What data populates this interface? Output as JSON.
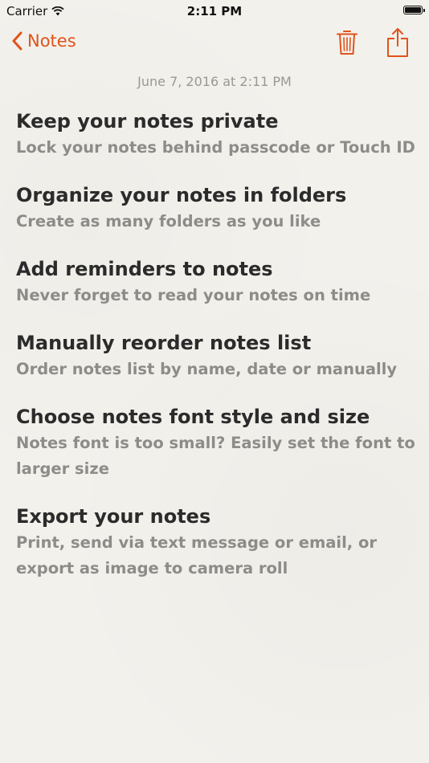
{
  "status_bar": {
    "carrier": "Carrier",
    "time": "2:11 PM",
    "battery_level": 1.0,
    "wifi_icon": "wifi-icon"
  },
  "nav": {
    "back_label": "Notes",
    "back_icon": "chevron-left-icon",
    "trash_icon": "trash-icon",
    "share_icon": "share-icon",
    "accent_color": "#e0531a"
  },
  "note": {
    "date": "June 7, 2016 at 2:11 PM",
    "sections": [
      {
        "title": "Keep your notes private",
        "body": "Lock your notes behind passcode or Touch ID"
      },
      {
        "title": "Organize your notes in folders",
        "body": "Create as many folders as you like"
      },
      {
        "title": "Add reminders to notes",
        "body": "Never forget to read your notes on time"
      },
      {
        "title": "Manually reorder notes list",
        "body": "Order notes list by name, date or manually"
      },
      {
        "title": "Choose notes font style and size",
        "body": "Notes font is too small? Easily set the font to larger size"
      },
      {
        "title": "Export your notes",
        "body": "Print, send via text message or email, or export as image to camera roll"
      }
    ]
  }
}
